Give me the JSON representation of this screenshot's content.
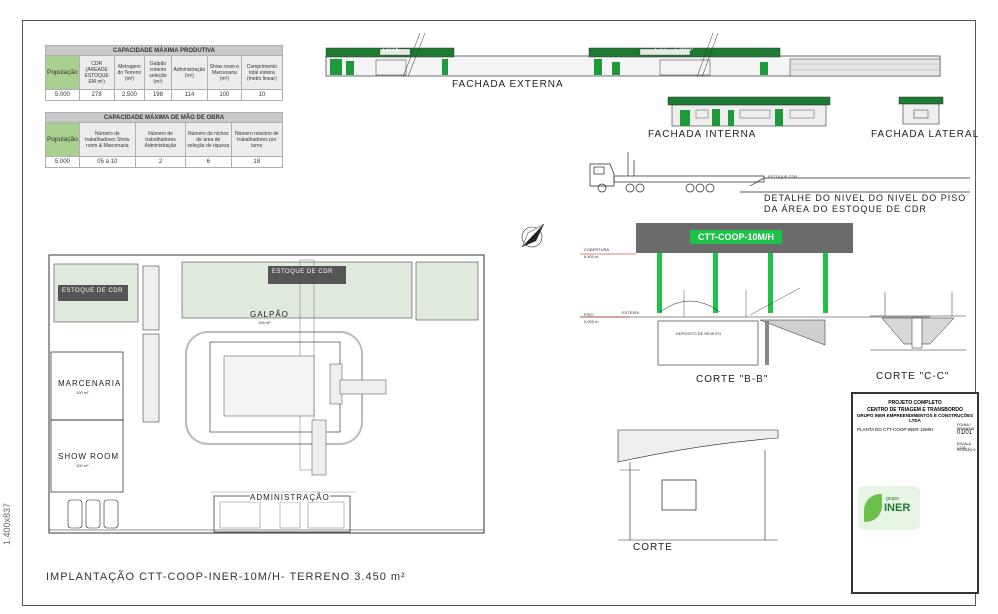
{
  "production_table": {
    "title": "CAPACIDADE MÁXIMA PRODUTIVA",
    "headers": [
      "População",
      "CDR (ÁREADE ESTOQUE EM m²)",
      "Metragem do Terreno (m²)",
      "Galpão coberto seleção (m²)",
      "Administração (m²)",
      "Show room e Marcenaria (m²)",
      "Comprimento total esteira (metro linear)"
    ],
    "row": [
      "5.000",
      "278",
      "2.500",
      "198",
      "114",
      "100",
      "10"
    ]
  },
  "labor_table": {
    "title": "CAPACIDADE MÁXIMA DE MÃO DE OBRA",
    "headers": [
      "População",
      "Número de trabalhadores Show room & Marcenaria",
      "Número de trabalhadores Administração",
      "Número de nichos de área de seleção de riqueza",
      "Número máximo de trabalhadores por turno"
    ],
    "row": [
      "5.000",
      "05 à 10",
      "2",
      "6",
      "18"
    ]
  },
  "facades": {
    "external_label": "FACHADA EXTERNA",
    "internal_label": "FACHADA INTERNA",
    "lateral_label": "FACHADA LATERAL",
    "loja_sign": "LOJA",
    "ctt_sign": "CTT - COOP"
  },
  "detail": {
    "estoque_note": "ESTOQUE CDR",
    "title_line1": "DETALHE DO NIVEL DO NIVEL DO PISO",
    "title_line2": "DA ÁREA DO ESTOQUE DE CDR"
  },
  "section_bb": {
    "banner": "CTT-COOP-10M/H",
    "label": "CORTE \"B-B\"",
    "cobertura": "COBERTURA",
    "cobertura_level": "6.400 m",
    "piso": "PISO",
    "piso_level": "0.000 m",
    "note_esteira": "ESTEIRA",
    "note_rejeito": "DEPÓSITO DE REJEITO"
  },
  "section_cc": {
    "label": "CORTE \"C-C\""
  },
  "section_plain": {
    "label": "CORTE"
  },
  "site_plan": {
    "title": "IMPLANTAÇÃO CTT-COOP-INER-10M/H- TERRENO 3.450 m²",
    "estoque": "ESTOQUE DE CDR",
    "galpao": "GALPÃO",
    "galpao_area": "198 m²",
    "marcenaria": "MARCENARIA",
    "marcenaria_area": "100 m²",
    "showroom": "SHOW ROOM",
    "showroom_area": "100 m²",
    "administracao": "ADMINISTRAÇÃO"
  },
  "title_block": {
    "project_line1": "PROJETO COMPLETO",
    "project_line2": "CENTRO DE TRIAGEM E TRANSBORDO",
    "project_line3": "GRUPO INER EMPREENDIMENTOS E CONSTRUÇÕES LTDA",
    "drawing_name": "PLANTA DO CTT-COOP-INER-10M/H",
    "sheet_label": "FOLHA / PRANCHA",
    "sheet_number": "01/01",
    "scale": "ESCALA 1:100",
    "revision": "REVISÃO 0",
    "logo_text": "INER",
    "logo_caption": "grupo"
  },
  "side_code": "1.400x837",
  "colors": {
    "green": "#1f9a3a",
    "roof": "#1d7a33",
    "banner": "#6b6b6b",
    "table_header": "#a9d08e",
    "line": "#222222"
  },
  "icons": [
    "north-arrow-icon",
    "truck-icon",
    "car-icon",
    "iner-logo-icon"
  ]
}
